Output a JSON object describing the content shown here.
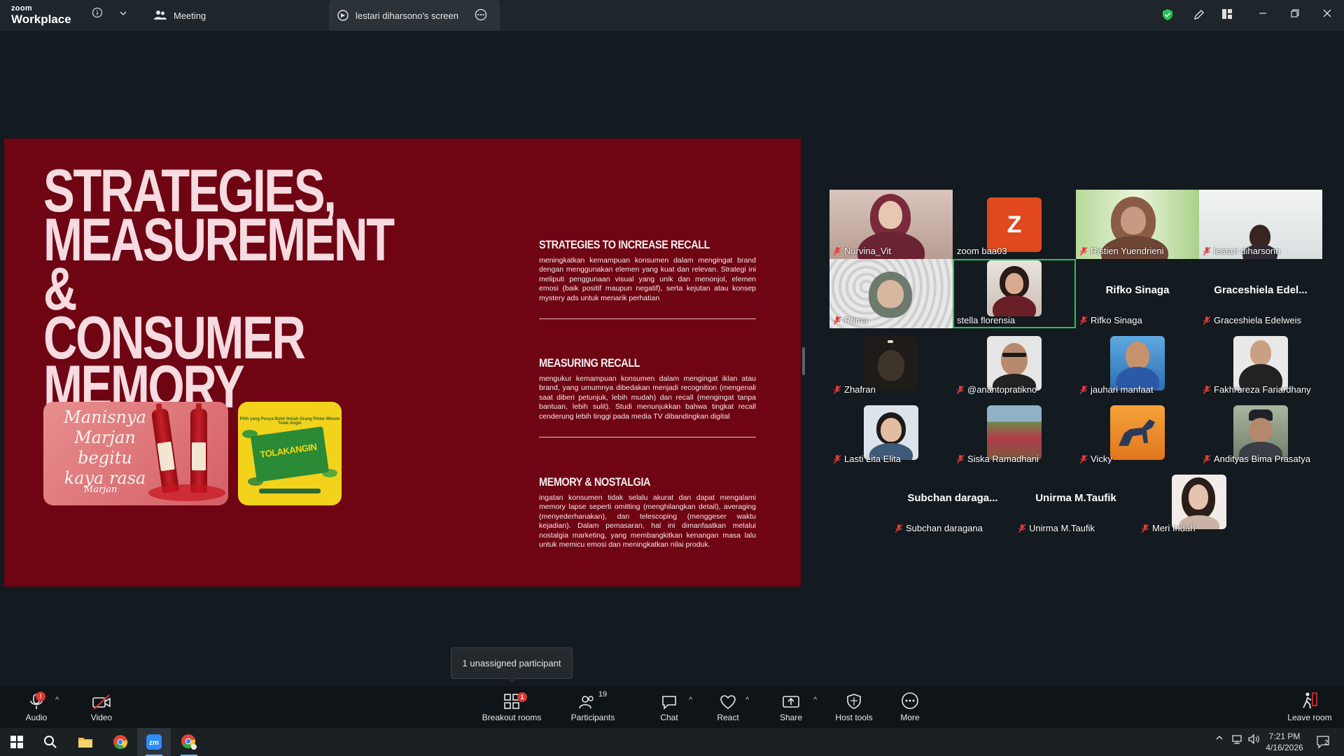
{
  "app": {
    "logo_line1": "zoom",
    "logo_line2": "Workplace"
  },
  "tabs": [
    {
      "label": "Meeting"
    },
    {
      "label": "lestari diharsono's screen"
    }
  ],
  "slide": {
    "title_lines": [
      "STRATEGIES,",
      "MEASUREMENT &",
      "CONSUMER",
      "MEMORY"
    ],
    "ad1": {
      "script": "Manisnya Marjan begitu kaya rasa",
      "brand": "Marjan"
    },
    "ad2": {
      "tagline": "Pilih yang Punya Bukti Ilmiah Orang Pintar Minum Tolak Angin",
      "brand": "TOLAKANGIN"
    },
    "sections": [
      {
        "heading": "STRATEGIES TO INCREASE RECALL",
        "body": "meningkatkan kemampuan konsumen dalam mengingat brand dengan menggunakan elemen yang kuat dan relevan. Strategi ini meliputi penggunaan visual yang unik dan menonjol, elemen emosi (baik positif maupun negatif), serta kejutan atau konsep mystery ads untuk menarik perhatian"
      },
      {
        "heading": "MEASURING RECALL",
        "body": "mengukur kemampuan konsumen dalam mengingat iklan atau brand, yang umumnya dibedakan menjadi recognition (mengenali saat diberi petunjuk, lebih mudah) dan recall (mengingat tanpa bantuan, lebih sulit). Studi menunjukkan bahwa tingkat recall cenderung lebih tinggi pada media TV dibandingkan digital"
      },
      {
        "heading": "MEMORY & NOSTALGIA",
        "body": "ingatan konsumen tidak selalu akurat dan dapat mengalami memory lapse seperti omitting (menghilangkan detail), averaging (menyederhanakan), dan telescoping (menggeser waktu kejadian). Dalam pemasaran, hal ini dimanfaatkan melalui nostalgia marketing, yang membangkitkan kenangan masa lalu untuk memicu emosi dan meningkatkan nilai produk."
      }
    ]
  },
  "participants": [
    {
      "name": "Nurvina_Vit",
      "kind": "video"
    },
    {
      "name": "zoom baa03",
      "kind": "letter",
      "letter": "Z"
    },
    {
      "name": "Ristien Yuendrieni",
      "kind": "video"
    },
    {
      "name": "lestari diharsono",
      "kind": "video"
    },
    {
      "name": "Prima",
      "kind": "video"
    },
    {
      "name": "stella florensia",
      "kind": "video"
    },
    {
      "name": "Rifko Sinaga",
      "kind": "nameonly",
      "display": "Rifko Sinaga"
    },
    {
      "name": "Graceshiela Edelweis",
      "kind": "nameonly",
      "display": "Graceshiela  Edel..."
    },
    {
      "name": "Zhafran",
      "kind": "photo"
    },
    {
      "name": "@anantopratikno",
      "kind": "photo"
    },
    {
      "name": "jauhari manfaat",
      "kind": "photo"
    },
    {
      "name": "Fakhrureza Fariardhany",
      "kind": "photo"
    },
    {
      "name": "Lasti Lita Elita",
      "kind": "photo"
    },
    {
      "name": "Siska Ramadhani",
      "kind": "photo"
    },
    {
      "name": "Vicky",
      "kind": "photo"
    },
    {
      "name": "Andityas Bima Prasatya",
      "kind": "photo"
    },
    {
      "name": "Subchan daragana",
      "kind": "nameonly",
      "display": "Subchan  daraga..."
    },
    {
      "name": "Unirma M.Taufik",
      "kind": "nameonly",
      "display": "Unirma M.Taufik"
    },
    {
      "name": "Meri Indah",
      "kind": "photo"
    }
  ],
  "tooltip": {
    "text": "1 unassigned participant"
  },
  "controls": {
    "audio": "Audio",
    "video": "Video",
    "breakout": "Breakout rooms",
    "breakout_badge": "1",
    "participants": "Participants",
    "participants_count": "19",
    "chat": "Chat",
    "react": "React",
    "share": "Share",
    "host_tools": "Host tools",
    "more": "More",
    "leave": "Leave room",
    "audio_badge": "!"
  },
  "taskbar": {
    "time": "7:21 PM",
    "date": "4/16/2026",
    "notif_count": "2"
  },
  "colors": {
    "slide_bg": "#6f0413",
    "slide_title": "#f7dbe0",
    "active_speaker": "#23c552",
    "alert": "#e0342c"
  }
}
